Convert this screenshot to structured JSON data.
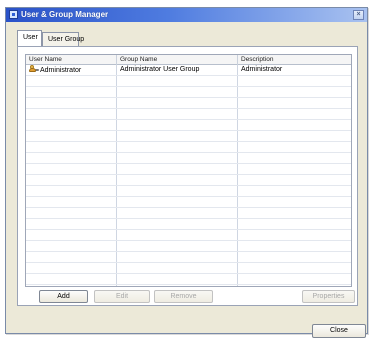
{
  "window": {
    "title": "User & Group Manager",
    "close_glyph": "×",
    "accent_color": "#2a52c9"
  },
  "tabs": [
    {
      "label": "User",
      "active": true
    },
    {
      "label": "User Group",
      "active": false
    }
  ],
  "table": {
    "columns": [
      "User Name",
      "Group Name",
      "Description"
    ],
    "rows": [
      {
        "icon": "user-icon",
        "user_name": "Administrator",
        "group_name": "Administrator User Group",
        "description": "Administrator"
      }
    ]
  },
  "buttons": {
    "add": {
      "label": "Add",
      "enabled": true
    },
    "edit": {
      "label": "Edit",
      "enabled": false
    },
    "remove": {
      "label": "Remove",
      "enabled": false
    },
    "properties": {
      "label": "Properties",
      "enabled": false
    },
    "close": {
      "label": "Close",
      "enabled": true
    }
  }
}
